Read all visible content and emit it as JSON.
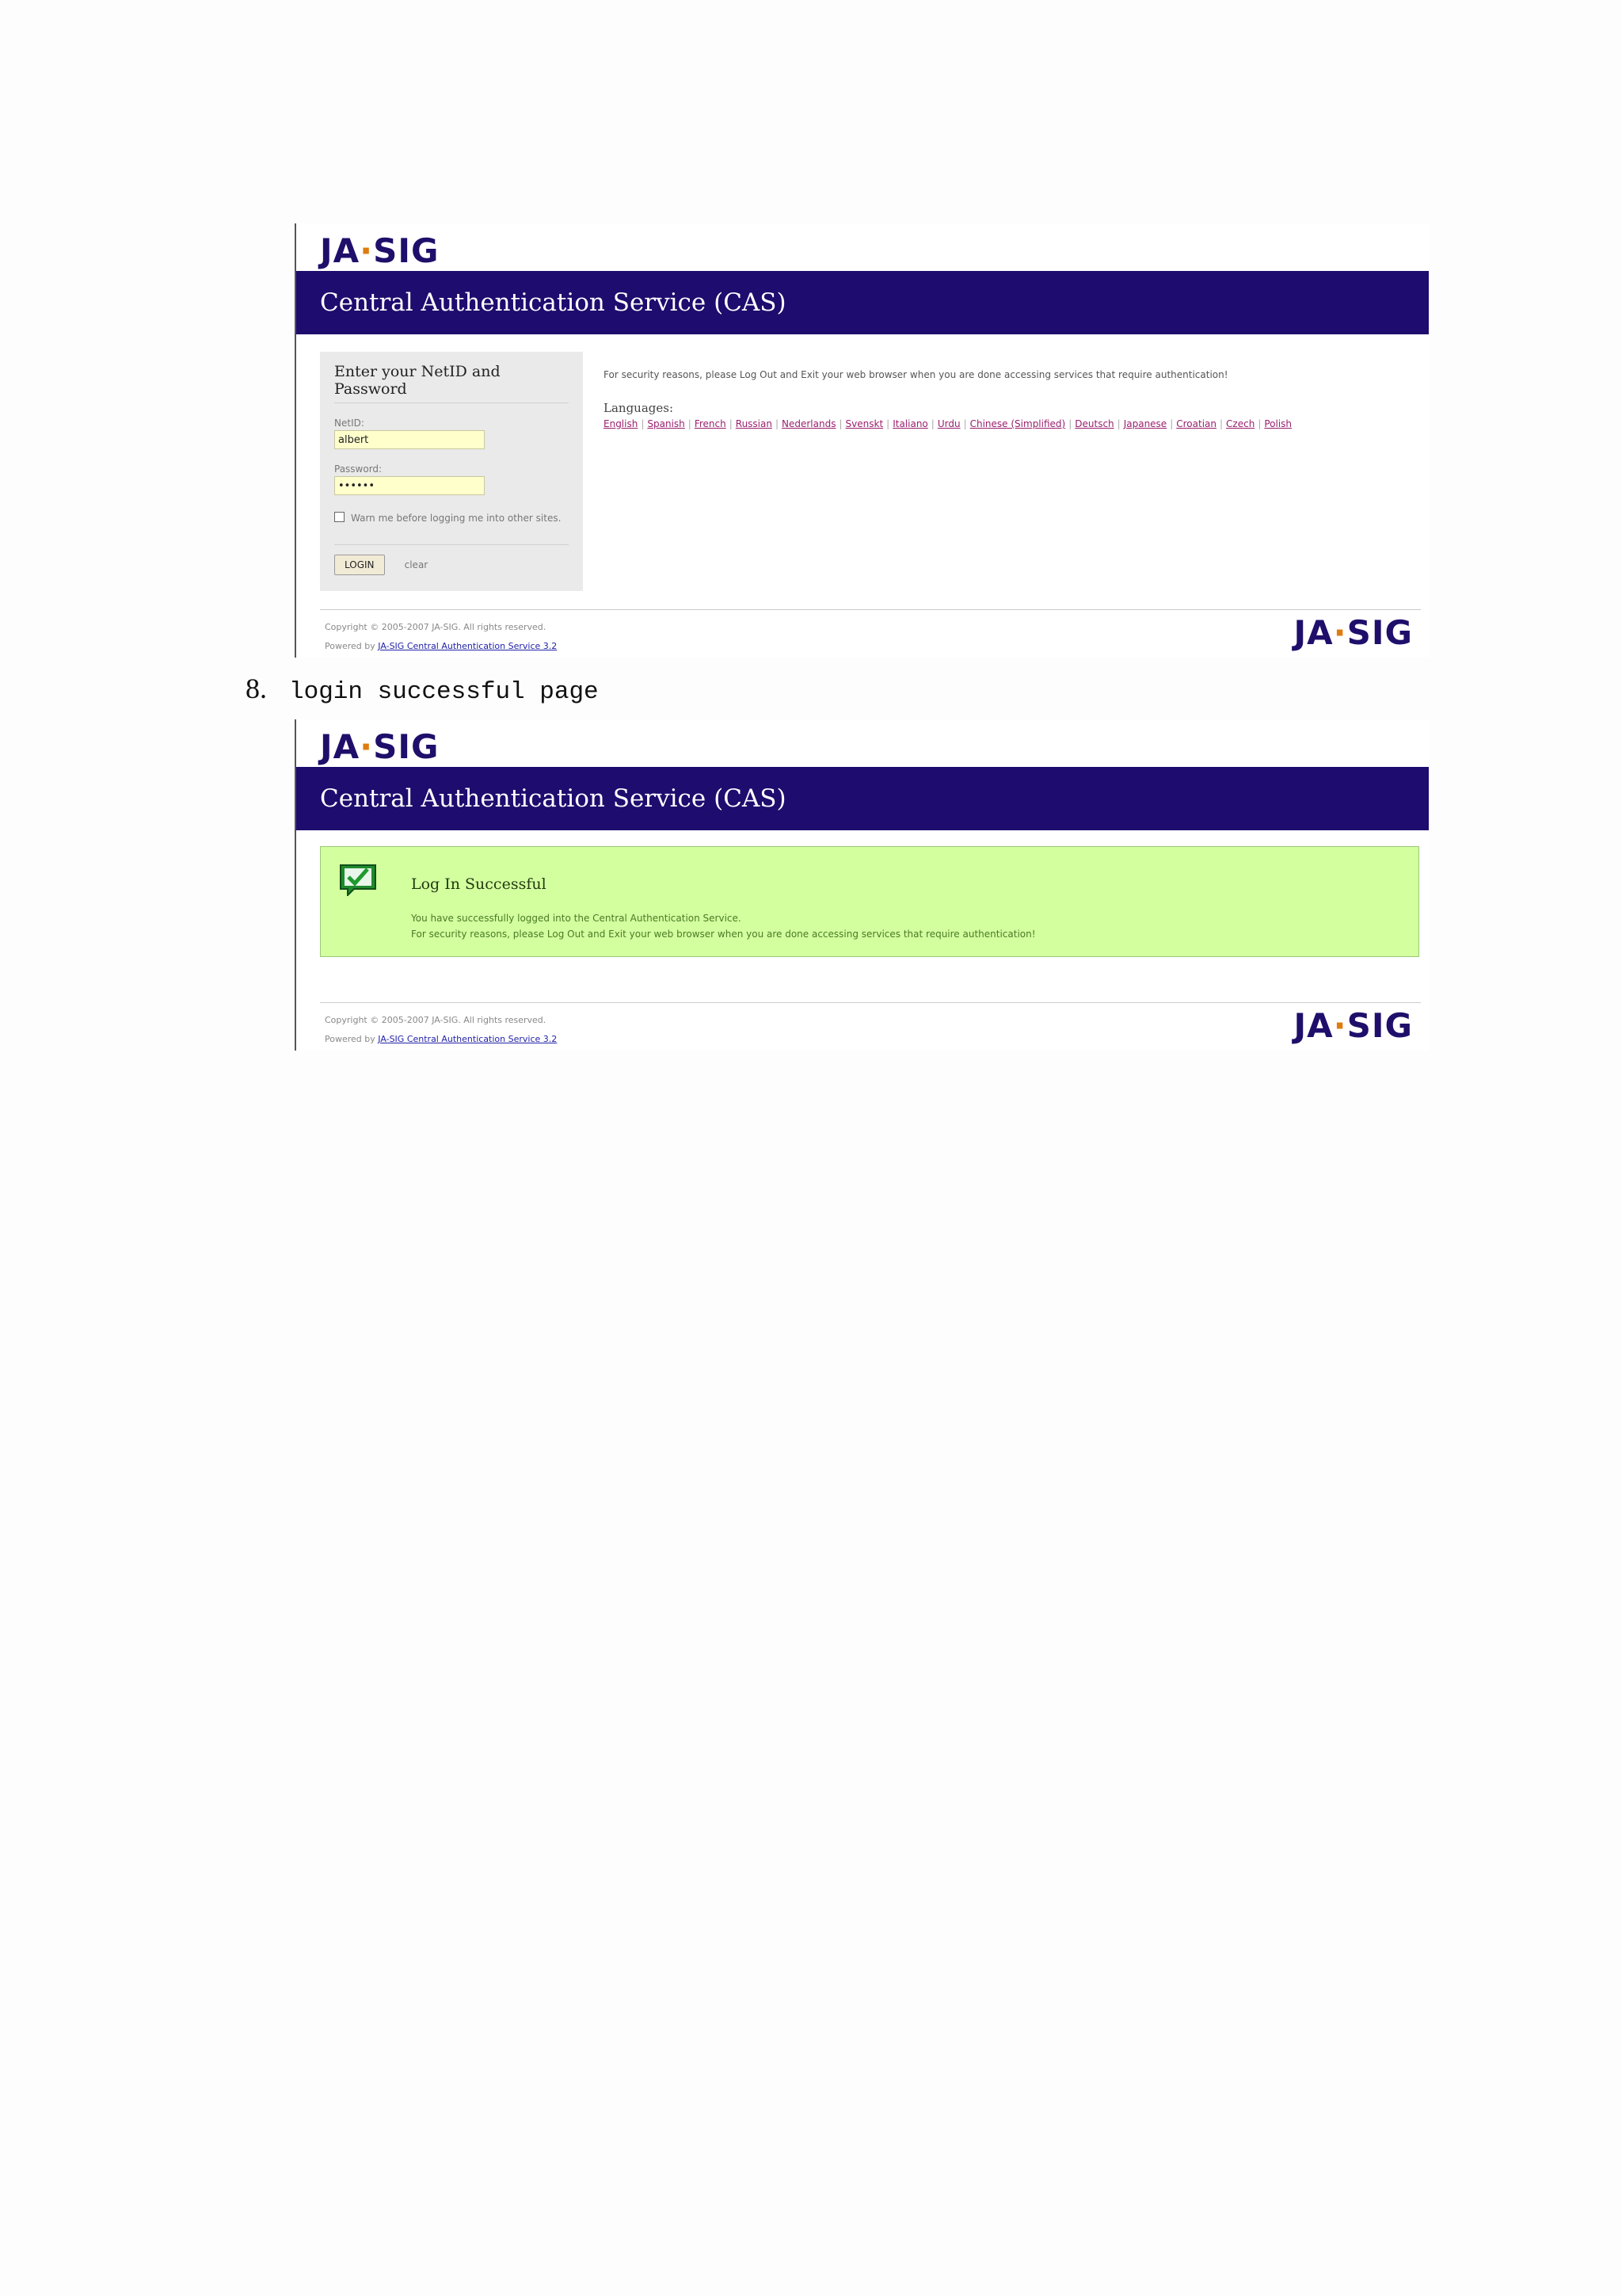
{
  "brand": {
    "logo_text_left": "JA",
    "logo_text_dot": "·",
    "logo_text_right": "SIG"
  },
  "banner_title": "Central Authentication Service (CAS)",
  "login_page": {
    "box_title": "Enter your NetID and Password",
    "netid_label": "NetID:",
    "netid_value": "albert",
    "password_label": "Password:",
    "password_value": "••••••",
    "warn_label": "Warn me before logging me into other sites.",
    "login_button": "LOGIN",
    "clear_link": "clear",
    "security_notice": "For security reasons, please Log Out and Exit your web browser when you are done accessing services that require authentication!",
    "languages_label": "Languages:",
    "languages": [
      "English",
      "Spanish",
      "French",
      "Russian",
      "Nederlands",
      "Svenskt",
      "Italiano",
      "Urdu",
      "Chinese (Simplified)",
      "Deutsch",
      "Japanese",
      "Croatian",
      "Czech",
      "Polish"
    ]
  },
  "footer": {
    "copyright": "Copyright © 2005-2007 JA-SIG. All rights reserved.",
    "powered_by": "Powered by",
    "powered_link": "JA-SIG Central Authentication Service 3.2"
  },
  "caption": {
    "number": "8.",
    "text": "login successful page"
  },
  "success_page": {
    "title": "Log In Successful",
    "line1": "You have successfully logged into the Central Authentication Service.",
    "line2": "For security reasons, please Log Out and Exit your web browser when you are done accessing services that require authentication!"
  },
  "colors": {
    "banner": "#1e0c6e",
    "logo": "#1f0f6b",
    "success_bg": "#d3ff9f"
  }
}
